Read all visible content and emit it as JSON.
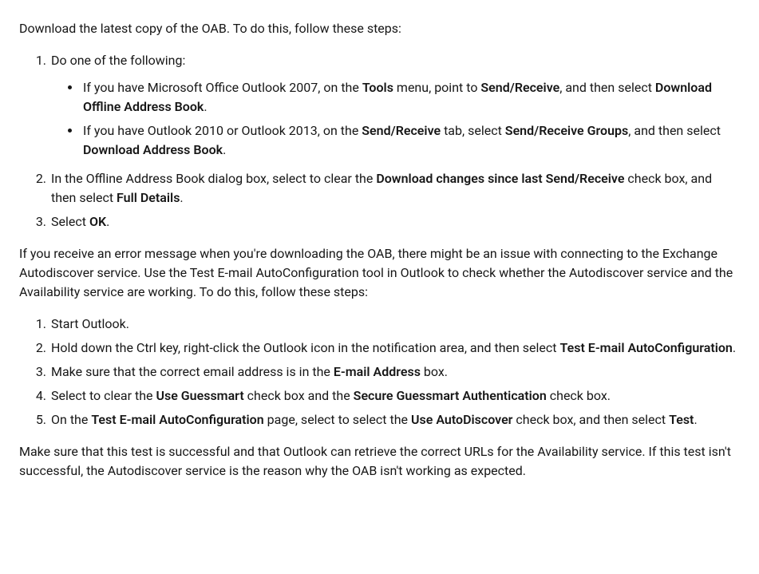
{
  "intro1": "Download the latest copy of the OAB. To do this, follow these steps:",
  "ol1": {
    "li1_lead": "Do one of the following:",
    "bul": {
      "b1": {
        "pre": "If you have Microsoft Office Outlook 2007, on the ",
        "bold1": "Tools",
        "mid1": " menu, point to ",
        "bold2": "Send/Receive",
        "mid2": ", and then select ",
        "bold3": "Download Offline Address Book",
        "post": "."
      },
      "b2": {
        "pre": "If you have Outlook 2010 or Outlook 2013, on the ",
        "bold1": "Send/Receive",
        "mid1": " tab, select ",
        "bold2": "Send/Receive Groups",
        "mid2": ", and then select ",
        "bold3": "Download Address Book",
        "post": "."
      }
    },
    "li2": {
      "pre": "In the Offline Address Book dialog box, select to clear the ",
      "bold1": "Download changes since last Send/Receive",
      "mid1": " check box, and then select ",
      "bold2": "Full Details",
      "post": "."
    },
    "li3": {
      "pre": "Select ",
      "bold1": "OK",
      "post": "."
    }
  },
  "para2": "If you receive an error message when you're downloading the OAB, there might be an issue with connecting to the Exchange Autodiscover service. Use the Test E-mail AutoConfiguration tool in Outlook to check whether the Autodiscover service and the Availability service are working. To do this, follow these steps:",
  "ol2": {
    "li1": "Start Outlook.",
    "li2": {
      "pre": "Hold down the Ctrl key, right-click the Outlook icon in the notification area, and then select ",
      "bold1": "Test E-mail AutoConfiguration",
      "post": "."
    },
    "li3": {
      "pre": "Make sure that the correct email address is in the ",
      "bold1": "E-mail Address",
      "post": " box."
    },
    "li4": {
      "pre": "Select to clear the ",
      "bold1": "Use Guessmart",
      "mid1": " check box and the ",
      "bold2": "Secure Guessmart Authentication",
      "post": " check box."
    },
    "li5": {
      "pre": "On the ",
      "bold1": "Test E-mail AutoConfiguration",
      "mid1": " page, select to select the ",
      "bold2": "Use AutoDiscover",
      "mid2": " check box, and then select ",
      "bold3": "Test",
      "post": "."
    }
  },
  "para3": "Make sure that this test is successful and that Outlook can retrieve the correct URLs for the Availability service. If this test isn't successful, the Autodiscover service is the reason why the OAB isn't working as expected."
}
